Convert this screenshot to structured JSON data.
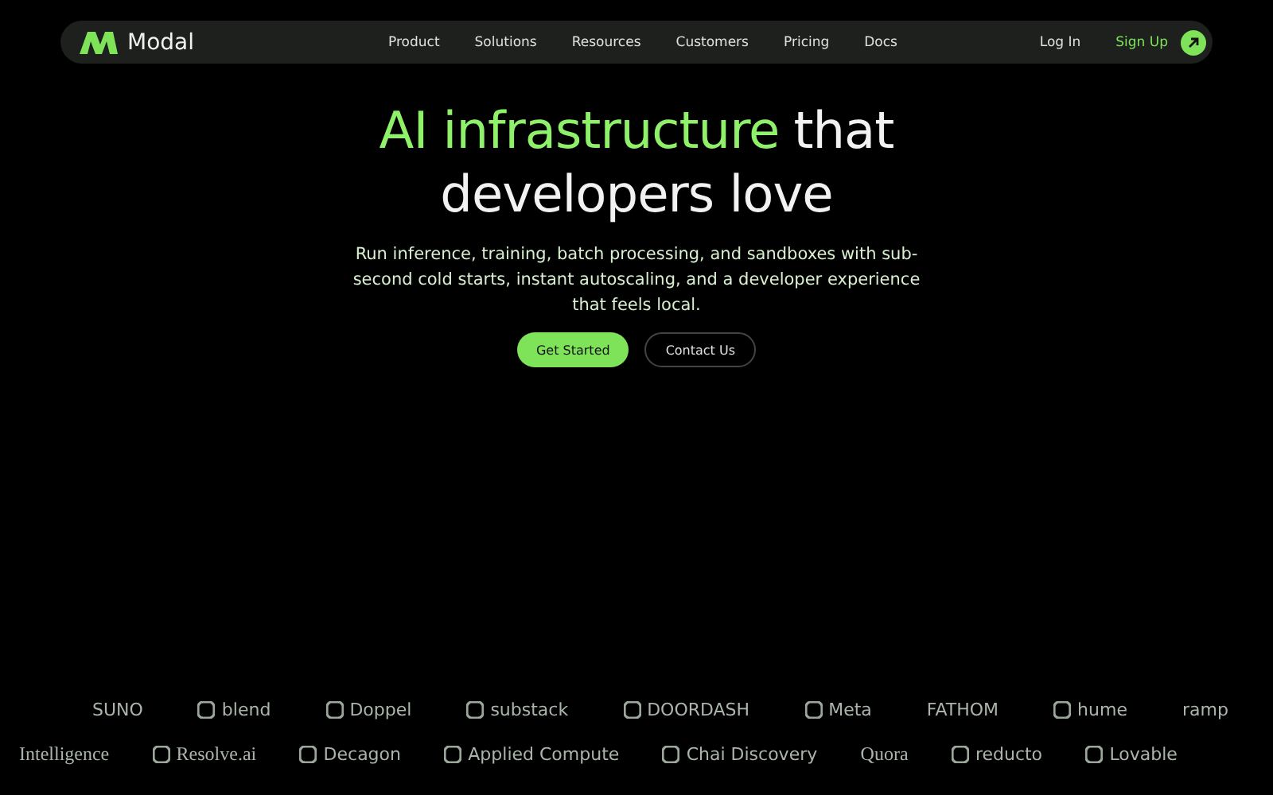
{
  "nav": {
    "brand": "Modal",
    "links": [
      "Product",
      "Solutions",
      "Resources",
      "Customers",
      "Pricing",
      "Docs"
    ],
    "login": "Log In",
    "signup": "Sign Up"
  },
  "hero": {
    "headline_lines": [
      [
        {
          "text": "AI infrastructure",
          "highlight": true
        },
        {
          "text": "that",
          "highlight": false
        }
      ],
      [
        {
          "text": "developers love",
          "highlight": false
        }
      ]
    ],
    "subtitle": "Run inference, training, batch processing, and sandboxes with sub-second cold starts, instant autoscaling, and a developer experience that feels local.",
    "buttons": [
      {
        "label": "Get Started",
        "kind": "primary"
      },
      {
        "label": "Contact Us",
        "kind": "secondary"
      }
    ]
  },
  "logo_rows": [
    [
      {
        "name": "SUNO",
        "kind": "text"
      },
      {
        "name": "blend",
        "kind": "mark"
      },
      {
        "name": "Doppel",
        "kind": "mark"
      },
      {
        "name": "substack",
        "kind": "mark"
      },
      {
        "name": "DOORDASH",
        "kind": "mark"
      },
      {
        "name": "Meta",
        "kind": "mark"
      },
      {
        "name": "FATHOM",
        "kind": "text"
      },
      {
        "name": "hume",
        "kind": "mark"
      },
      {
        "name": "ramp",
        "kind": "text"
      }
    ],
    [
      {
        "name": "Intelligence",
        "kind": "serif"
      },
      {
        "name": "Resolve.ai",
        "kind": "serif-mark"
      },
      {
        "name": "Decagon",
        "kind": "mark"
      },
      {
        "name": "Applied Compute",
        "kind": "mark"
      },
      {
        "name": "Chai Discovery",
        "kind": "mark"
      },
      {
        "name": "Quora",
        "kind": "serif"
      },
      {
        "name": "reducto",
        "kind": "mark"
      },
      {
        "name": "Lovable",
        "kind": "mark"
      }
    ]
  ]
}
